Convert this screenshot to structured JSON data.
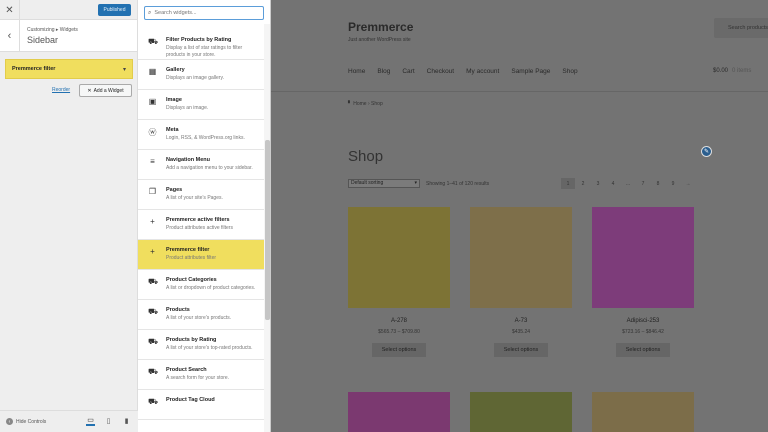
{
  "customizer": {
    "close_icon": "close-icon",
    "publish_label": "Published",
    "breadcrumb": "Customizing ▸ Widgets",
    "section_title": "Sidebar",
    "widget_title": "Premmerce filter",
    "reorder_label": "Reorder",
    "add_widget_label": "Add a Widget",
    "hide_controls_label": "Hide Controls"
  },
  "picker": {
    "search_placeholder": "Search widgets...",
    "items": [
      {
        "name": "Filter Products by Rating",
        "desc": "Display a list of star ratings to filter products in your store.",
        "icon": "cart-icon"
      },
      {
        "name": "Gallery",
        "desc": "Displays an image gallery.",
        "icon": "gallery-icon"
      },
      {
        "name": "Image",
        "desc": "Displays an image.",
        "icon": "image-icon"
      },
      {
        "name": "Meta",
        "desc": "Login, RSS, & WordPress.org links.",
        "icon": "wordpress-icon"
      },
      {
        "name": "Navigation Menu",
        "desc": "Add a navigation menu to your sidebar.",
        "icon": "menu-icon"
      },
      {
        "name": "Pages",
        "desc": "A list of your site’s Pages.",
        "icon": "pages-icon"
      },
      {
        "name": "Premmerce active filters",
        "desc": "Product attributes active filters",
        "icon": "plus-icon"
      },
      {
        "name": "Premmerce filter",
        "desc": "Product attributes filter",
        "icon": "plus-icon"
      },
      {
        "name": "Product Categories",
        "desc": "A list or dropdown of product categories.",
        "icon": "cart-icon"
      },
      {
        "name": "Products",
        "desc": "A list of your store's products.",
        "icon": "cart-icon"
      },
      {
        "name": "Products by Rating",
        "desc": "A list of your store's top-rated products.",
        "icon": "cart-icon"
      },
      {
        "name": "Product Search",
        "desc": "A search form for your store.",
        "icon": "cart-icon"
      },
      {
        "name": "Product Tag Cloud",
        "desc": "",
        "icon": "cart-icon"
      }
    ]
  },
  "preview": {
    "site_title": "Premmerce",
    "tagline": "Just another WordPress site",
    "search_placeholder": "Search products…",
    "nav": [
      "Home",
      "Blog",
      "Cart",
      "Checkout",
      "My account",
      "Sample Page",
      "Shop"
    ],
    "cart_total": "$0.00",
    "cart_items": "0 items",
    "breadcrumb_home": "Home",
    "breadcrumb_sep": "›",
    "breadcrumb_current": "Shop",
    "page_title": "Shop",
    "sort_value": "Default sorting",
    "result_count": "Showing 1–41 of 120 results",
    "pagination": [
      "1",
      "2",
      "3",
      "4",
      "…",
      "7",
      "8",
      "9",
      "→"
    ],
    "products": [
      {
        "name": "A-278",
        "price": "$565.73 – $709.80",
        "button": "Select options",
        "color": "#7d7335"
      },
      {
        "name": "A-73",
        "price": "$435.24",
        "button": "Select options",
        "color": "#7e6f4a"
      },
      {
        "name": "Adipisci-253",
        "price": "$723.16 – $846.42",
        "button": "Select options",
        "color": "#7d3c7a"
      }
    ],
    "row2_colors": [
      "#7b3970",
      "#5f6634",
      "#7c6d49"
    ]
  }
}
